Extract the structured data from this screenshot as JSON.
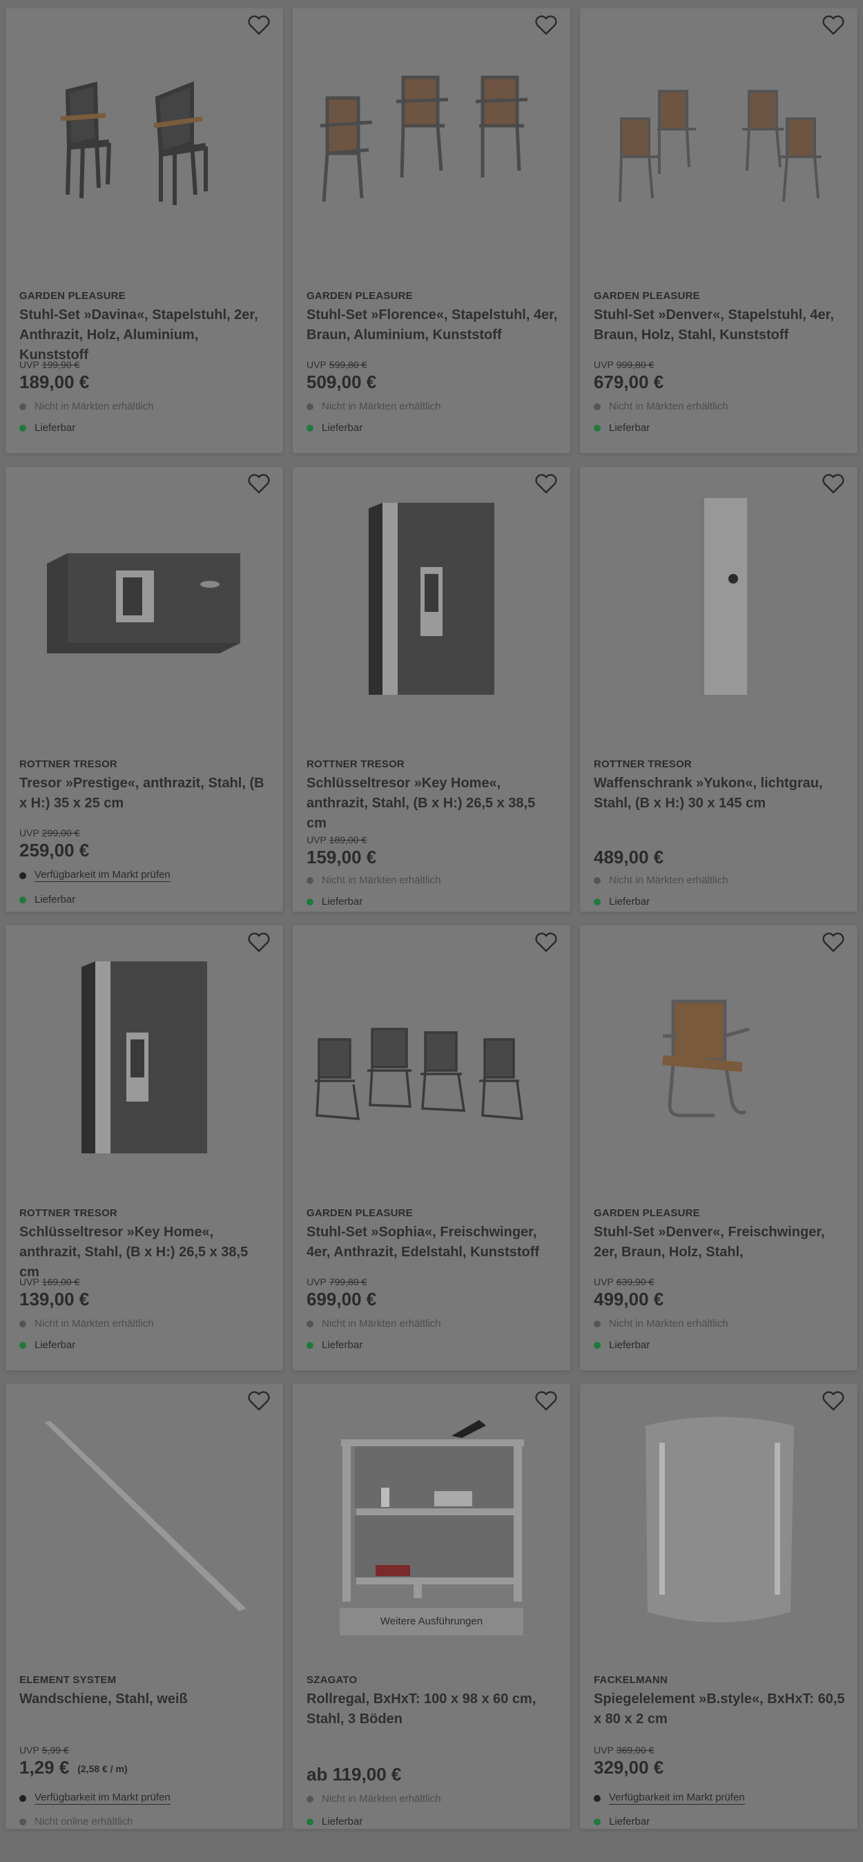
{
  "products": [
    {
      "brand": "GARDEN PLEASURE",
      "title": "Stuhl-Set »Davina«, Stapelstuhl, 2er, Anthrazit, Holz, Aluminium, Kunststoff",
      "uvp_label": "UVP",
      "uvp": "199,90 €",
      "price": "189,00 €",
      "store": "Nicht in Märkten erhältlich",
      "delivery": "Lieferbar",
      "image_icon": "two-stacking-chairs"
    },
    {
      "brand": "GARDEN PLEASURE",
      "title": "Stuhl-Set »Florence«, Stapelstuhl, 4er, Braun, Aluminium, Kunststoff",
      "uvp_label": "UVP",
      "uvp": "599,80 €",
      "price": "509,00 €",
      "store": "Nicht in Märkten erhältlich",
      "delivery": "Lieferbar",
      "image_icon": "three-wood-chairs"
    },
    {
      "brand": "GARDEN PLEASURE",
      "title": "Stuhl-Set »Denver«, Stapelstuhl, 4er, Braun, Holz, Stahl, Kunststoff",
      "uvp_label": "UVP",
      "uvp": "999,80 €",
      "price": "679,00 €",
      "store": "Nicht in Märkten erhältlich",
      "delivery": "Lieferbar",
      "image_icon": "four-wood-chairs"
    },
    {
      "brand": "ROTTNER TRESOR",
      "title": "Tresor »Prestige«, anthrazit, Stahl, (B x H:) 35 x 25 cm",
      "uvp_label": "UVP",
      "uvp": "299,00 €",
      "price": "259,00 €",
      "store": "Verfügbarkeit im Markt prüfen",
      "delivery": "Lieferbar",
      "image_icon": "safe"
    },
    {
      "brand": "ROTTNER TRESOR",
      "title": "Schlüsseltresor »Key Home«, anthrazit, Stahl, (B x H:) 26,5 x 38,5 cm",
      "uvp_label": "UVP",
      "uvp": "189,00 €",
      "price": "159,00 €",
      "store": "Nicht in Märkten erhältlich",
      "delivery": "Lieferbar",
      "image_icon": "key-safe"
    },
    {
      "brand": "ROTTNER TRESOR",
      "title": "Waffenschrank »Yukon«, lichtgrau, Stahl, (B x H:) 30 x 145 cm",
      "uvp_label": "",
      "uvp": "",
      "price": "489,00 €",
      "store": "Nicht in Märkten erhältlich",
      "delivery": "Lieferbar",
      "image_icon": "gun-cabinet"
    },
    {
      "brand": "ROTTNER TRESOR",
      "title": "Schlüsseltresor »Key Home«, anthrazit, Stahl, (B x H:) 26,5 x 38,5 cm",
      "uvp_label": "UVP",
      "uvp": "169,00 €",
      "price": "139,00 €",
      "store": "Nicht in Märkten erhältlich",
      "delivery": "Lieferbar",
      "image_icon": "key-safe"
    },
    {
      "brand": "GARDEN PLEASURE",
      "title": "Stuhl-Set »Sophia«, Freischwinger, 4er, Anthrazit, Edelstahl, Kunststoff",
      "uvp_label": "UVP",
      "uvp": "799,80 €",
      "price": "699,00 €",
      "store": "Nicht in Märkten erhältlich",
      "delivery": "Lieferbar",
      "image_icon": "four-cantilever-chairs"
    },
    {
      "brand": "GARDEN PLEASURE",
      "title": "Stuhl-Set »Denver«, Freischwinger, 2er, Braun, Holz, Stahl,",
      "uvp_label": "UVP",
      "uvp": "639,90 €",
      "price": "499,00 €",
      "store": "Nicht in Märkten erhältlich",
      "delivery": "Lieferbar",
      "image_icon": "cantilever-wood-chair"
    },
    {
      "brand": "ELEMENT SYSTEM",
      "title": "Wandschiene, Stahl, weiß",
      "uvp_label": "UVP",
      "uvp": "5,99 €",
      "price": "1,29 €",
      "unit_price": "(2,58 € / m)",
      "store": "Verfügbarkeit im Markt prüfen",
      "delivery": "Nicht online erhältlich",
      "image_icon": "wall-rail"
    },
    {
      "brand": "SZAGATO",
      "title": "Rollregal, BxHxT: 100 x 98 x 60 cm, Stahl, 3 Böden",
      "uvp_label": "",
      "uvp": "",
      "price": "ab 119,00 €",
      "store": "Nicht in Märkten erhältlich",
      "delivery": "Lieferbar",
      "variant_label": "Weitere Ausführungen",
      "image_icon": "rolling-shelf"
    },
    {
      "brand": "FACKELMANN",
      "title": "Spiegelelement »B.style«, BxHxT: 60,5 x 80 x 2 cm",
      "uvp_label": "UVP",
      "uvp": "369,00 €",
      "price": "329,00 €",
      "store": "Verfügbarkeit im Markt prüfen",
      "delivery": "Lieferbar",
      "image_icon": "mirror"
    }
  ],
  "colors": {
    "overlay": "#6f6f6f",
    "card": "#797979",
    "available": "#1f7a3c"
  }
}
